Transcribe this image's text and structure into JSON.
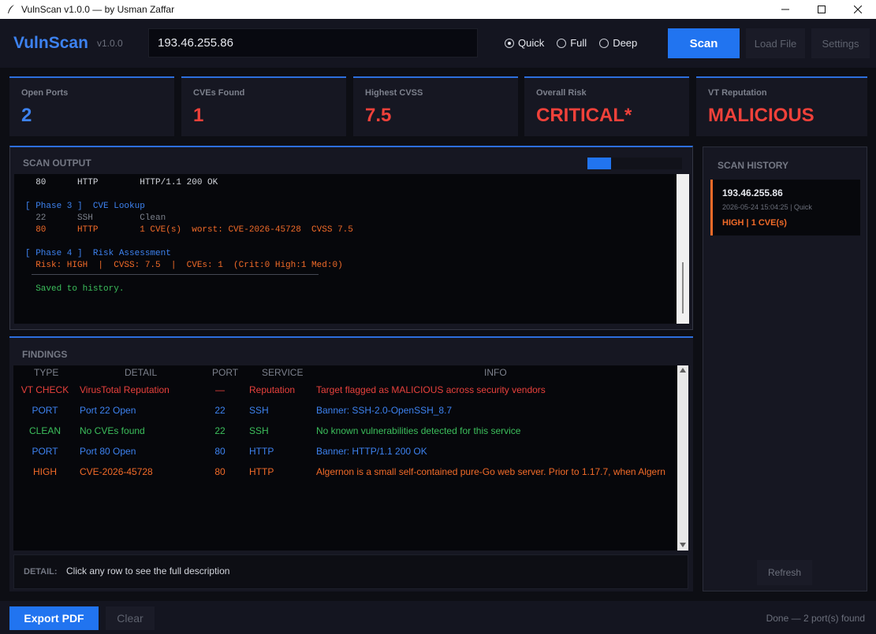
{
  "window": {
    "title": "VulnScan v1.0.0 — by Usman Zaffar"
  },
  "header": {
    "brand": "VulnScan",
    "version": "v1.0.0",
    "target_value": "193.46.255.86",
    "modes": [
      {
        "label": "Quick",
        "selected": true
      },
      {
        "label": "Full",
        "selected": false
      },
      {
        "label": "Deep",
        "selected": false
      }
    ],
    "scan_label": "Scan",
    "load_label": "Load File",
    "settings_label": "Settings"
  },
  "stats": [
    {
      "label": "Open Ports",
      "value": "2",
      "color": "#3d82f0"
    },
    {
      "label": "CVEs Found",
      "value": "1",
      "color": "#f0413a"
    },
    {
      "label": "Highest CVSS",
      "value": "7.5",
      "color": "#f0413a"
    },
    {
      "label": "Overall Risk",
      "value": "CRITICAL*",
      "color": "#f0413a"
    },
    {
      "label": "VT Reputation",
      "value": "MALICIOUS",
      "color": "#f0413a"
    }
  ],
  "scan_output": {
    "title": "SCAN OUTPUT",
    "progress": 0.25,
    "lines": [
      {
        "text": "  80      HTTP        HTTP/1.1 200 OK",
        "color": "c-hi"
      },
      {
        "text": "",
        "color": "c-dim"
      },
      {
        "text": "[ Phase 3 ]  CVE Lookup",
        "color": "c-blue"
      },
      {
        "text": "  22      SSH         Clean",
        "color": "c-dim"
      },
      {
        "text": "  80      HTTP        1 CVE(s)  worst: CVE-2026-45728  CVSS 7.5",
        "color": "c-orange"
      },
      {
        "text": "",
        "color": "c-dim"
      },
      {
        "text": "[ Phase 4 ]  Risk Assessment",
        "color": "c-blue"
      },
      {
        "text": "  Risk: HIGH  |  CVSS: 7.5  |  CVEs: 1  (Crit:0 High:1 Med:0)",
        "color": "c-orange"
      },
      {
        "text": "",
        "color": "c-dim"
      },
      {
        "text": "  Saved to history.",
        "color": "c-green"
      }
    ]
  },
  "findings": {
    "title": "FINDINGS",
    "columns": [
      "TYPE",
      "DETAIL",
      "PORT",
      "SERVICE",
      "INFO"
    ],
    "rows": [
      {
        "type": "VT CHECK",
        "detail": "VirusTotal Reputation",
        "port": "—",
        "service": "Reputation",
        "info": "Target flagged as MALICIOUS across security vendors",
        "color": "#e8413c"
      },
      {
        "type": "PORT",
        "detail": "Port 22 Open",
        "port": "22",
        "service": "SSH",
        "info": "Banner: SSH-2.0-OpenSSH_8.7",
        "color": "#3d82f0"
      },
      {
        "type": "CLEAN",
        "detail": "No CVEs found",
        "port": "22",
        "service": "SSH",
        "info": "No known vulnerabilities detected for this service",
        "color": "#3cbf5c"
      },
      {
        "type": "PORT",
        "detail": "Port 80 Open",
        "port": "80",
        "service": "HTTP",
        "info": "Banner: HTTP/1.1 200 OK",
        "color": "#3d82f0"
      },
      {
        "type": "HIGH",
        "detail": "CVE-2026-45728",
        "port": "80",
        "service": "HTTP",
        "info": "Algernon is a small self-contained pure-Go web server. Prior to 1.17.7, when Algern",
        "color": "#f26b28"
      }
    ],
    "detail_label": "DETAIL:",
    "detail_text": "Click any row to see the full description"
  },
  "history": {
    "title": "SCAN HISTORY",
    "items": [
      {
        "ip": "193.46.255.86",
        "meta": "2026-05-24 15:04:25  |  Quick",
        "summary": "HIGH  |  1 CVE(s)"
      }
    ],
    "refresh_label": "Refresh"
  },
  "footer": {
    "export_label": "Export PDF",
    "clear_label": "Clear",
    "status": "Done — 2 port(s) found"
  }
}
